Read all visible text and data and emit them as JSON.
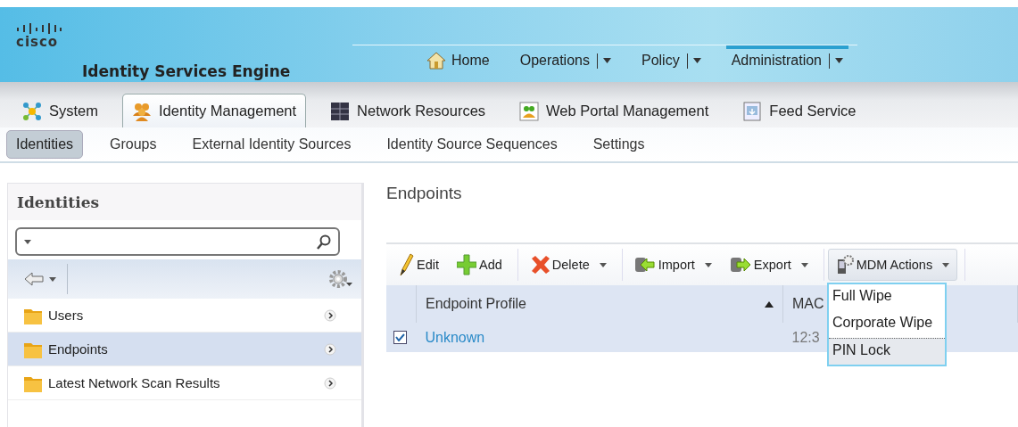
{
  "header": {
    "logo": "cisco",
    "product": "Identity Services Engine",
    "nav": [
      {
        "label": "Home",
        "kind": "home",
        "selected": false
      },
      {
        "label": "Operations",
        "kind": "menu",
        "selected": false
      },
      {
        "label": "Policy",
        "kind": "menu",
        "selected": false
      },
      {
        "label": "Administration",
        "kind": "menu",
        "selected": true
      }
    ]
  },
  "tabs": [
    {
      "label": "System",
      "kind": "system",
      "selected": false
    },
    {
      "label": "Identity Management",
      "kind": "people",
      "selected": true
    },
    {
      "label": "Network Resources",
      "kind": "grid",
      "selected": false
    },
    {
      "label": "Web Portal Management",
      "kind": "portal",
      "selected": false
    },
    {
      "label": "Feed Service",
      "kind": "feed",
      "selected": false
    }
  ],
  "subtabs": [
    {
      "label": "Identities",
      "selected": true
    },
    {
      "label": "Groups",
      "selected": false
    },
    {
      "label": "External Identity Sources",
      "selected": false
    },
    {
      "label": "Identity Source Sequences",
      "selected": false
    },
    {
      "label": "Settings",
      "selected": false
    }
  ],
  "sidebar": {
    "title": "Identities",
    "items": [
      {
        "label": "Users",
        "selected": false
      },
      {
        "label": "Endpoints",
        "selected": true
      },
      {
        "label": "Latest Network Scan Results",
        "selected": false
      }
    ]
  },
  "content": {
    "title": "Endpoints",
    "toolbar": [
      {
        "label": "Edit",
        "kind": "edit",
        "dropdown": false,
        "open": false
      },
      {
        "label": "Add",
        "kind": "add",
        "dropdown": false,
        "open": false
      },
      {
        "label": "Delete",
        "kind": "delete",
        "dropdown": true,
        "open": false
      },
      {
        "label": "Import",
        "kind": "import",
        "dropdown": true,
        "open": false
      },
      {
        "label": "Export",
        "kind": "export",
        "dropdown": true,
        "open": false
      },
      {
        "label": "MDM Actions",
        "kind": "mdm",
        "dropdown": true,
        "open": true
      }
    ],
    "menu": [
      {
        "label": "Full Wipe",
        "selected": false
      },
      {
        "label": "Corporate Wipe",
        "selected": false
      },
      {
        "label": "PIN Lock",
        "selected": true
      }
    ],
    "columns": [
      {
        "label": "Endpoint Profile",
        "sorted": true
      },
      {
        "label": "MAC",
        "sorted": false
      }
    ],
    "rows": [
      {
        "checked": true,
        "cells": [
          "Unknown",
          "12:3"
        ]
      }
    ]
  }
}
